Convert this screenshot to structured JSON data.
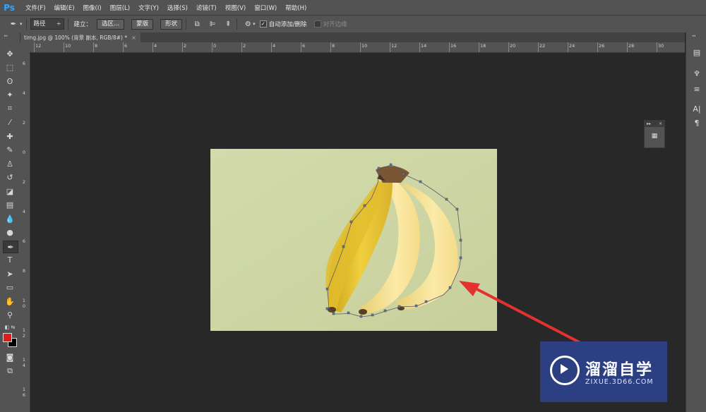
{
  "app": {
    "logo": "Ps"
  },
  "menu": [
    "文件(F)",
    "编辑(E)",
    "图像(I)",
    "图层(L)",
    "文字(Y)",
    "选择(S)",
    "滤镜(T)",
    "视图(V)",
    "窗口(W)",
    "帮助(H)"
  ],
  "options": {
    "mode_value": "路径",
    "make_label": "建立：",
    "selection_btn": "选区...",
    "mask_btn": "蒙版",
    "shape_btn": "形状",
    "auto_add_label": "自动添加/删除",
    "auto_add_checked": true,
    "align_edges_label": "对齐边缘",
    "align_edges_checked": false
  },
  "document": {
    "tab_title": "timg.jpg @ 100% (背景 副本, RGB/8#) *",
    "close": "×"
  },
  "ruler": {
    "top": [
      "12",
      "10",
      "8",
      "6",
      "4",
      "2",
      "0",
      "2",
      "4",
      "6",
      "8",
      "10",
      "12",
      "14",
      "16",
      "18",
      "20",
      "22",
      "24",
      "26",
      "28",
      "30"
    ],
    "left": [
      "6",
      "4",
      "2",
      "0",
      "2",
      "4",
      "6",
      "8",
      "1 0",
      "1 2",
      "1 4",
      "1 6"
    ]
  },
  "float_panel": {
    "expand": "▸▸",
    "close": "×"
  },
  "colors": {
    "foreground": "#e01b1b",
    "background": "#000000"
  },
  "watermark": {
    "title": "溜溜自学",
    "subtitle": "ZIXUE.3D66.COM"
  },
  "tools": [
    "move-tool",
    "marquee-tool",
    "lasso-tool",
    "quick-select-tool",
    "crop-tool",
    "eyedropper-tool",
    "healing-tool",
    "brush-tool",
    "clone-stamp-tool",
    "history-brush-tool",
    "eraser-tool",
    "gradient-tool",
    "blur-tool",
    "dodge-tool",
    "pen-tool",
    "type-tool",
    "path-select-tool",
    "rectangle-tool",
    "hand-tool",
    "zoom-tool"
  ]
}
